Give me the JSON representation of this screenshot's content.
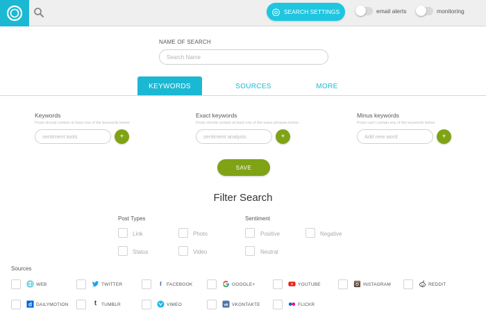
{
  "topbar": {
    "settings_label": "SEARCH SETTINGS",
    "email_alerts_label": "email alerts",
    "monitoring_label": "monitoring"
  },
  "name_of_search": {
    "label": "NAME OF SEARCH",
    "placeholder": "Search Name"
  },
  "tabs": [
    {
      "label": "KEYWORDS",
      "active": true
    },
    {
      "label": "SOURCES",
      "active": false
    },
    {
      "label": "MORE",
      "active": false
    }
  ],
  "keywords": {
    "keywords": {
      "title": "Keywords",
      "hint": "Posts should contain at least one of the keywords below",
      "placeholder": "sentiment tools"
    },
    "exact": {
      "title": "Exact keywords",
      "hint": "Posts should contain at least one of the exact phrases below",
      "placeholder": "sentiment analysis"
    },
    "minus": {
      "title": "Minus keywords",
      "hint": "Posts can't contain any of the keywords below",
      "placeholder": "Add new word"
    },
    "add_label": "+",
    "save_label": "SAVE"
  },
  "filter": {
    "title": "Filter Search",
    "post_types_label": "Post Types",
    "post_types": [
      "Link",
      "Photo",
      "Status",
      "Video"
    ],
    "sentiment_label": "Sentiment",
    "sentiments": [
      "Positive",
      "Negative",
      "Neutral"
    ]
  },
  "sources": {
    "label": "Sources",
    "items": [
      {
        "label": "WEB",
        "icon": "globe-icon",
        "color": "#1bb8d3"
      },
      {
        "label": "TWITTER",
        "icon": "twitter-icon",
        "color": "#1da1f2"
      },
      {
        "label": "FACEBOOK",
        "icon": "facebook-icon",
        "color": "#3b5998"
      },
      {
        "label": "GOOGLE+",
        "icon": "google-icon",
        "color": "#db4437"
      },
      {
        "label": "YOUTUBE",
        "icon": "youtube-icon",
        "color": "#e62117"
      },
      {
        "label": "INSTAGRAM",
        "icon": "instagram-icon",
        "color": "#555555"
      },
      {
        "label": "REDDIT",
        "icon": "reddit-icon",
        "color": "#333333"
      },
      {
        "label": "DAILYMOTION",
        "icon": "dailymotion-icon",
        "color": "#0066dc"
      },
      {
        "label": "TUMBLR",
        "icon": "tumblr-icon",
        "color": "#35465c"
      },
      {
        "label": "VIMEO",
        "icon": "vimeo-icon",
        "color": "#1ab7ea"
      },
      {
        "label": "VKONTAKTE",
        "icon": "vk-icon",
        "color": "#4c75a3"
      },
      {
        "label": "FLICKR",
        "icon": "flickr-icon",
        "color": "#0063dc"
      }
    ]
  },
  "colors": {
    "accent": "#1bb8d3",
    "green": "#7fa315"
  }
}
